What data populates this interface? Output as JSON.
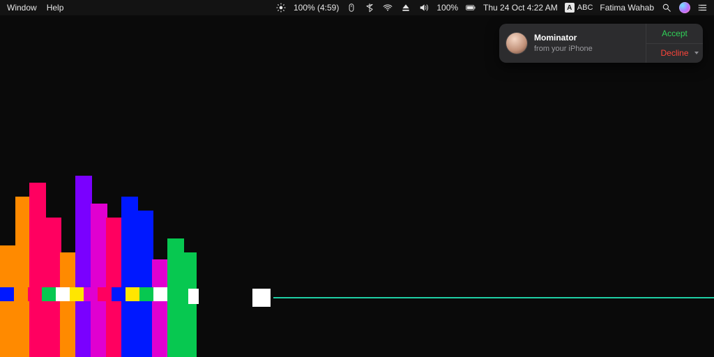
{
  "menubar": {
    "left": [
      "Window",
      "Help"
    ],
    "brightness_percent": "100% (4:59)",
    "battery_percent": "100%",
    "datetime": "Thu 24 Oct  4:22 AM",
    "input_badge_letter": "A",
    "input_badge_label": "ABC",
    "user_name": "Fatima Wahab"
  },
  "notification": {
    "caller": "Mominator",
    "subtitle": "from your iPhone",
    "accept": "Accept",
    "decline": "Decline"
  },
  "visualizer": {
    "accent_line_color": "#1fcfa5"
  }
}
